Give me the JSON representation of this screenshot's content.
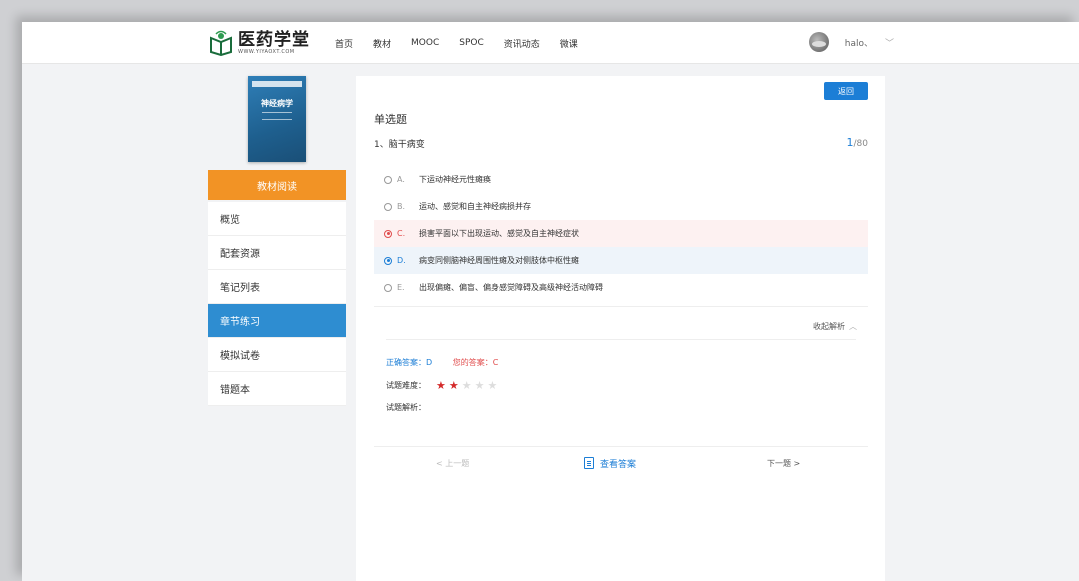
{
  "header": {
    "logo_cn": "医药学堂",
    "logo_url": "WWW.YIYAOXT.COM",
    "nav": [
      "首页",
      "教材",
      "MOOC",
      "SPOC",
      "资讯动态",
      "微课"
    ],
    "user_name": "halo、",
    "chevron": "﹀"
  },
  "sidebar": {
    "book_title": "神经病学",
    "read_button": "教材阅读",
    "menu": [
      "概览",
      "配套资源",
      "笔记列表",
      "章节练习",
      "模拟试卷",
      "错题本"
    ],
    "active_index": 3
  },
  "question": {
    "back": "返回",
    "type": "单选题",
    "stem": "1、脑干病变",
    "current": "1",
    "total": "/80",
    "options": [
      {
        "letter": "A.",
        "text": "下运动神经元性瘫痪",
        "state": "none"
      },
      {
        "letter": "B.",
        "text": "运动、感觉和自主神经病损并存",
        "state": "none"
      },
      {
        "letter": "C.",
        "text": "损害平面以下出现运动、感觉及自主神经症状",
        "state": "wrong"
      },
      {
        "letter": "D.",
        "text": "病变同侧脑神经周围性瘫及对侧肢体中枢性瘫",
        "state": "right"
      },
      {
        "letter": "E.",
        "text": "出现偏瘫、偏盲、偏身感觉障碍及高级神经活动障碍",
        "state": "none"
      }
    ],
    "collapse_label": "收起解析",
    "collapse_icon": "︿",
    "correct_answer": "正确答案：D",
    "your_answer": "您的答案：C",
    "difficulty_label": "试题难度：",
    "difficulty": 2,
    "difficulty_max": 5,
    "analysis_label": "试题解析：",
    "prev": "< 上一题",
    "view_answer": "查看答案",
    "next": "下一题 >"
  },
  "colors": {
    "accent_blue": "#1c7ed6",
    "orange": "#f29325",
    "active_menu": "#2e8dd1",
    "wrong_red": "#e04b4b"
  }
}
